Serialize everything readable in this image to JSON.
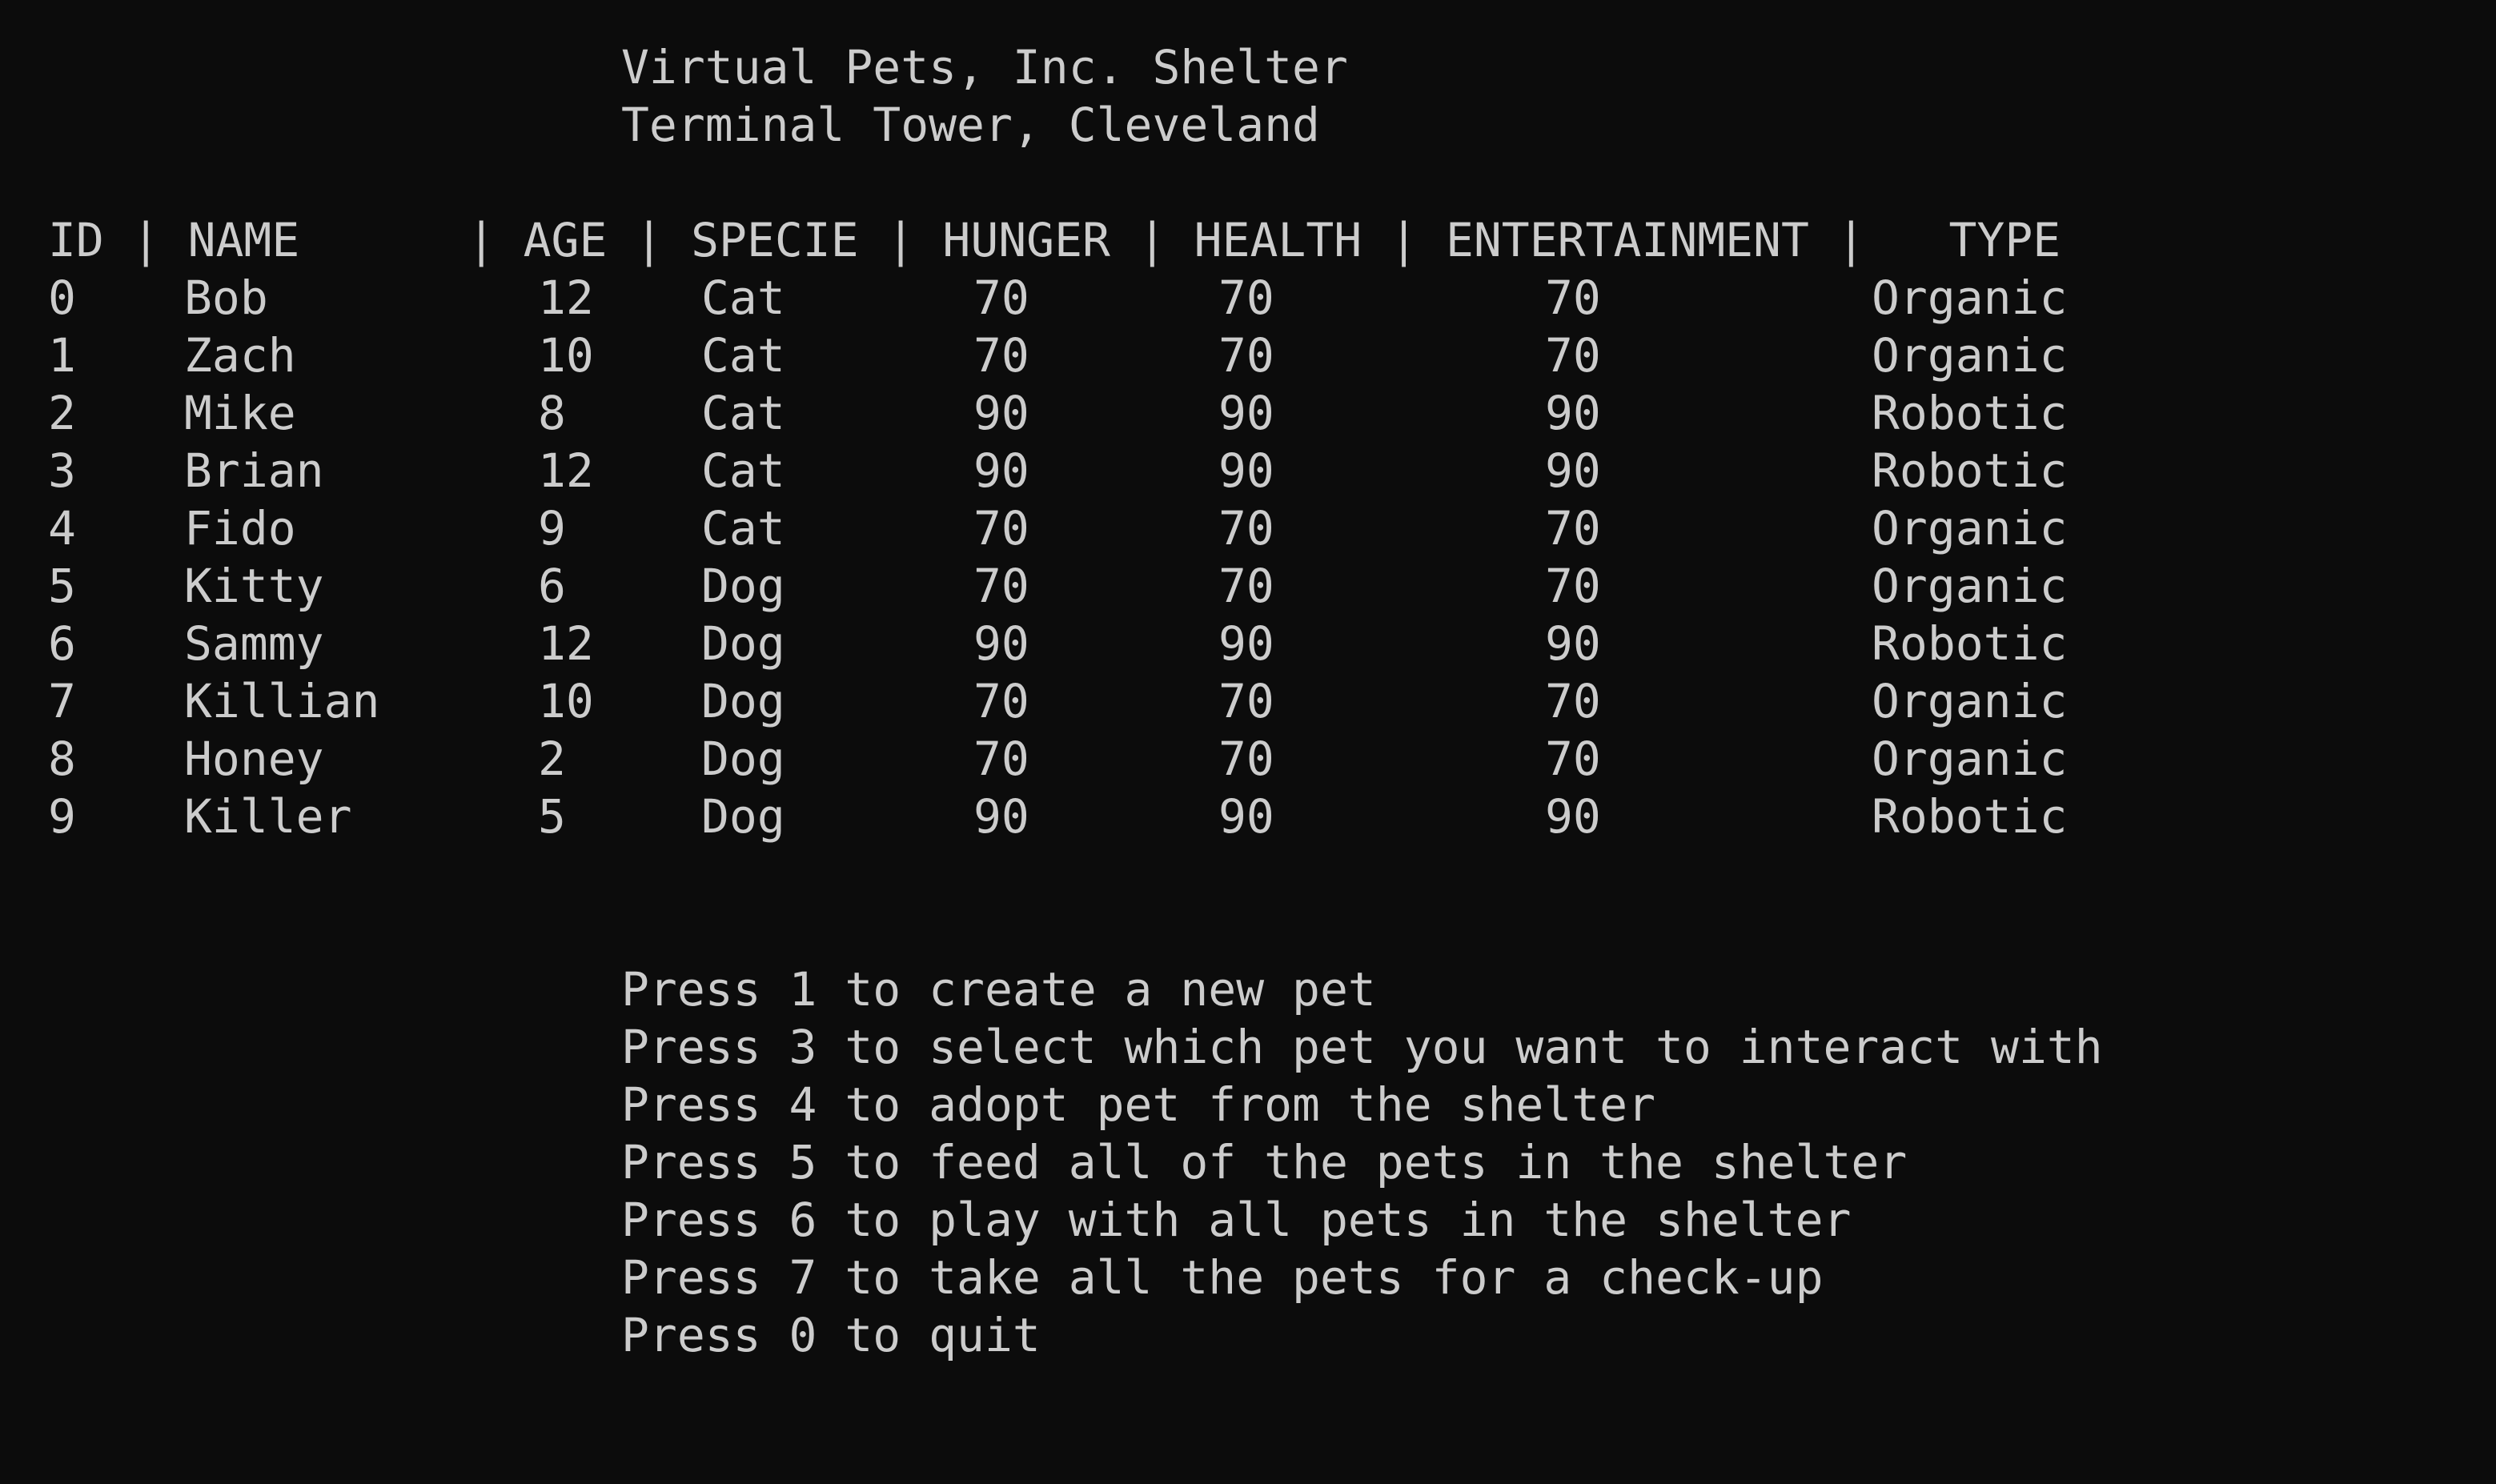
{
  "title": {
    "line1": "Virtual Pets, Inc. Shelter",
    "line2": "Terminal Tower, Cleveland"
  },
  "table": {
    "header": "ID | NAME      | AGE | SPECIE | HUNGER | HEALTH | ENTERTAINMENT |   TYPE",
    "rows": [
      {
        "id": "0",
        "name": "Bob",
        "age": "12",
        "specie": "Cat",
        "hunger": "70",
        "health": "70",
        "entertainment": "70",
        "type": "Organic"
      },
      {
        "id": "1",
        "name": "Zach",
        "age": "10",
        "specie": "Cat",
        "hunger": "70",
        "health": "70",
        "entertainment": "70",
        "type": "Organic"
      },
      {
        "id": "2",
        "name": "Mike",
        "age": "8",
        "specie": "Cat",
        "hunger": "90",
        "health": "90",
        "entertainment": "90",
        "type": "Robotic"
      },
      {
        "id": "3",
        "name": "Brian",
        "age": "12",
        "specie": "Cat",
        "hunger": "90",
        "health": "90",
        "entertainment": "90",
        "type": "Robotic"
      },
      {
        "id": "4",
        "name": "Fido",
        "age": "9",
        "specie": "Cat",
        "hunger": "70",
        "health": "70",
        "entertainment": "70",
        "type": "Organic"
      },
      {
        "id": "5",
        "name": "Kitty",
        "age": "6",
        "specie": "Dog",
        "hunger": "70",
        "health": "70",
        "entertainment": "70",
        "type": "Organic"
      },
      {
        "id": "6",
        "name": "Sammy",
        "age": "12",
        "specie": "Dog",
        "hunger": "90",
        "health": "90",
        "entertainment": "90",
        "type": "Robotic"
      },
      {
        "id": "7",
        "name": "Killian",
        "age": "10",
        "specie": "Dog",
        "hunger": "70",
        "health": "70",
        "entertainment": "70",
        "type": "Organic"
      },
      {
        "id": "8",
        "name": "Honey",
        "age": "2",
        "specie": "Dog",
        "hunger": "70",
        "health": "70",
        "entertainment": "70",
        "type": "Organic"
      },
      {
        "id": "9",
        "name": "Killer",
        "age": "5",
        "specie": "Dog",
        "hunger": "90",
        "health": "90",
        "entertainment": "90",
        "type": "Robotic"
      }
    ]
  },
  "menu": [
    "Press 1 to create a new pet",
    "Press 3 to select which pet you want to interact with",
    "Press 4 to adopt pet from the shelter",
    "Press 5 to feed all of the pets in the shelter",
    "Press 6 to play with all pets in the shelter",
    "Press 7 to take all the pets for a check-up",
    "Press 0 to quit"
  ],
  "colors": {
    "background": "#0c0c0c",
    "text": "#cccccc"
  }
}
